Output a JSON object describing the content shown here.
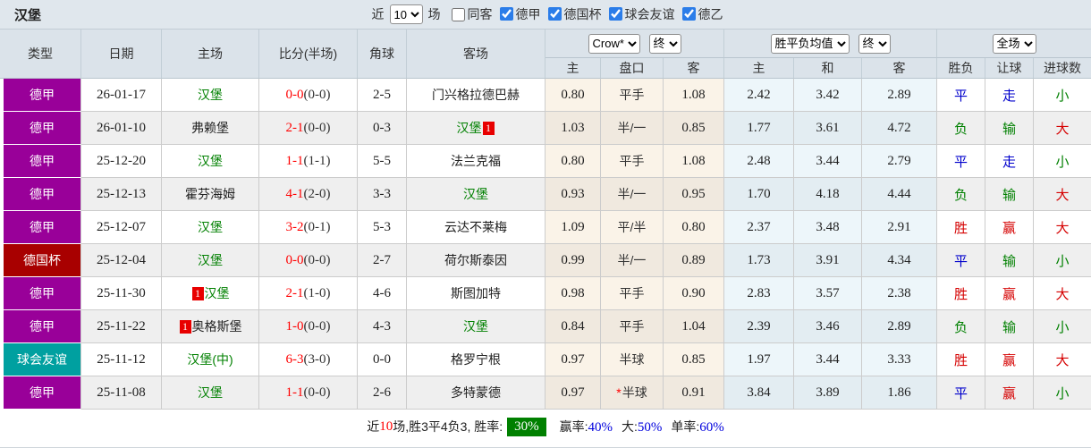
{
  "title": "汉堡",
  "badge_text": "1",
  "star_mark": "*",
  "controls": {
    "near_label": "近",
    "recent_count": "10",
    "matches_label": "场",
    "same_away": {
      "label": "同客",
      "checked": false
    },
    "leagues": [
      {
        "label": "德甲",
        "checked": true
      },
      {
        "label": "德国杯",
        "checked": true
      },
      {
        "label": "球会友谊",
        "checked": true
      },
      {
        "label": "德乙",
        "checked": true
      }
    ]
  },
  "header": {
    "col_type": "类型",
    "col_date": "日期",
    "col_home": "主场",
    "col_score": "比分(半场)",
    "col_corner": "角球",
    "col_away": "客场",
    "bookmaker_select": "Crow*",
    "asia_final_select": "终",
    "europe_select": "胜平负均值",
    "europe_final_select": "终",
    "full_select": "全场",
    "sub": [
      "主",
      "盘口",
      "客",
      "主",
      "和",
      "客",
      "胜负",
      "让球",
      "进球数"
    ]
  },
  "rows": [
    {
      "league": "德甲",
      "lc": "league-purple",
      "date": "26-01-17",
      "home": {
        "name": "汉堡",
        "green": true,
        "badge": ""
      },
      "ft": "0-0",
      "ht": "(0-0)",
      "corner": "2-5",
      "away": {
        "name": "门兴格拉德巴赫",
        "green": false,
        "badge": ""
      },
      "ah": [
        "0.80",
        "平手",
        "1.08"
      ],
      "star": false,
      "eu": [
        "2.42",
        "3.42",
        "2.89"
      ],
      "res": [
        [
          "平",
          "b"
        ],
        [
          "走",
          "b"
        ],
        [
          "小",
          "g"
        ]
      ]
    },
    {
      "league": "德甲",
      "lc": "league-purple",
      "date": "26-01-10",
      "home": {
        "name": "弗赖堡",
        "green": false,
        "badge": ""
      },
      "ft": "2-1",
      "ht": "(0-0)",
      "corner": "0-3",
      "away": {
        "name": "汉堡",
        "green": true,
        "badge": "after"
      },
      "ah": [
        "1.03",
        "半/一",
        "0.85"
      ],
      "star": false,
      "eu": [
        "1.77",
        "3.61",
        "4.72"
      ],
      "res": [
        [
          "负",
          "g"
        ],
        [
          "输",
          "g"
        ],
        [
          "大",
          "r"
        ]
      ]
    },
    {
      "league": "德甲",
      "lc": "league-purple",
      "date": "25-12-20",
      "home": {
        "name": "汉堡",
        "green": true,
        "badge": ""
      },
      "ft": "1-1",
      "ht": "(1-1)",
      "corner": "5-5",
      "away": {
        "name": "法兰克福",
        "green": false,
        "badge": ""
      },
      "ah": [
        "0.80",
        "平手",
        "1.08"
      ],
      "star": false,
      "eu": [
        "2.48",
        "3.44",
        "2.79"
      ],
      "res": [
        [
          "平",
          "b"
        ],
        [
          "走",
          "b"
        ],
        [
          "小",
          "g"
        ]
      ]
    },
    {
      "league": "德甲",
      "lc": "league-purple",
      "date": "25-12-13",
      "home": {
        "name": "霍芬海姆",
        "green": false,
        "badge": ""
      },
      "ft": "4-1",
      "ht": "(2-0)",
      "corner": "3-3",
      "away": {
        "name": "汉堡",
        "green": true,
        "badge": ""
      },
      "ah": [
        "0.93",
        "半/一",
        "0.95"
      ],
      "star": false,
      "eu": [
        "1.70",
        "4.18",
        "4.44"
      ],
      "res": [
        [
          "负",
          "g"
        ],
        [
          "输",
          "g"
        ],
        [
          "大",
          "r"
        ]
      ]
    },
    {
      "league": "德甲",
      "lc": "league-purple",
      "date": "25-12-07",
      "home": {
        "name": "汉堡",
        "green": true,
        "badge": ""
      },
      "ft": "3-2",
      "ht": "(0-1)",
      "corner": "5-3",
      "away": {
        "name": "云达不莱梅",
        "green": false,
        "badge": ""
      },
      "ah": [
        "1.09",
        "平/半",
        "0.80"
      ],
      "star": false,
      "eu": [
        "2.37",
        "3.48",
        "2.91"
      ],
      "res": [
        [
          "胜",
          "r"
        ],
        [
          "赢",
          "r"
        ],
        [
          "大",
          "r"
        ]
      ]
    },
    {
      "league": "德国杯",
      "lc": "league-darkred",
      "date": "25-12-04",
      "home": {
        "name": "汉堡",
        "green": true,
        "badge": ""
      },
      "ft": "0-0",
      "ht": "(0-0)",
      "corner": "2-7",
      "away": {
        "name": "荷尔斯泰因",
        "green": false,
        "badge": ""
      },
      "ah": [
        "0.99",
        "半/一",
        "0.89"
      ],
      "star": false,
      "eu": [
        "1.73",
        "3.91",
        "4.34"
      ],
      "res": [
        [
          "平",
          "b"
        ],
        [
          "输",
          "g"
        ],
        [
          "小",
          "g"
        ]
      ]
    },
    {
      "league": "德甲",
      "lc": "league-purple",
      "date": "25-11-30",
      "home": {
        "name": "汉堡",
        "green": true,
        "badge": "before"
      },
      "ft": "2-1",
      "ht": "(1-0)",
      "corner": "4-6",
      "away": {
        "name": "斯图加特",
        "green": false,
        "badge": ""
      },
      "ah": [
        "0.98",
        "平手",
        "0.90"
      ],
      "star": false,
      "eu": [
        "2.83",
        "3.57",
        "2.38"
      ],
      "res": [
        [
          "胜",
          "r"
        ],
        [
          "赢",
          "r"
        ],
        [
          "大",
          "r"
        ]
      ]
    },
    {
      "league": "德甲",
      "lc": "league-purple",
      "date": "25-11-22",
      "home": {
        "name": "奥格斯堡",
        "green": false,
        "badge": "before"
      },
      "ft": "1-0",
      "ht": "(0-0)",
      "corner": "4-3",
      "away": {
        "name": "汉堡",
        "green": true,
        "badge": ""
      },
      "ah": [
        "0.84",
        "平手",
        "1.04"
      ],
      "star": false,
      "eu": [
        "2.39",
        "3.46",
        "2.89"
      ],
      "res": [
        [
          "负",
          "g"
        ],
        [
          "输",
          "g"
        ],
        [
          "小",
          "g"
        ]
      ]
    },
    {
      "league": "球会友谊",
      "lc": "league-teal",
      "date": "25-11-12",
      "home": {
        "name": "汉堡(中)",
        "green": true,
        "badge": ""
      },
      "ft": "6-3",
      "ht": "(3-0)",
      "corner": "0-0",
      "away": {
        "name": "格罗宁根",
        "green": false,
        "badge": ""
      },
      "ah": [
        "0.97",
        "半球",
        "0.85"
      ],
      "star": false,
      "eu": [
        "1.97",
        "3.44",
        "3.33"
      ],
      "res": [
        [
          "胜",
          "r"
        ],
        [
          "赢",
          "r"
        ],
        [
          "大",
          "r"
        ]
      ]
    },
    {
      "league": "德甲",
      "lc": "league-purple",
      "date": "25-11-08",
      "home": {
        "name": "汉堡",
        "green": true,
        "badge": ""
      },
      "ft": "1-1",
      "ht": "(0-0)",
      "corner": "2-6",
      "away": {
        "name": "多特蒙德",
        "green": false,
        "badge": ""
      },
      "ah": [
        "0.97",
        "半球",
        "0.91"
      ],
      "star": true,
      "eu": [
        "3.84",
        "3.89",
        "1.86"
      ],
      "res": [
        [
          "平",
          "b"
        ],
        [
          "赢",
          "r"
        ],
        [
          "小",
          "g"
        ]
      ]
    }
  ],
  "footer": {
    "near_label": "近",
    "count": "10",
    "summary": "场,胜3平4负3, 胜率:",
    "win_rate": "30%",
    "stats": [
      {
        "label": "赢率:",
        "value": "40%"
      },
      {
        "label": "大:",
        "value": "50%"
      },
      {
        "label": "单率:",
        "value": "60%"
      }
    ]
  },
  "colors": {
    "league_purple": "#990099",
    "league_darkred": "#a80000",
    "league_teal": "#00a0a0",
    "team_green": "#008000",
    "score_red": "#ff0000",
    "result_red": "#d50000",
    "result_blue": "#0000cc",
    "result_green": "#008000",
    "rate_badge_green": "#008000",
    "stat_blue": "#0000dd",
    "badge_red": "#e80000"
  }
}
